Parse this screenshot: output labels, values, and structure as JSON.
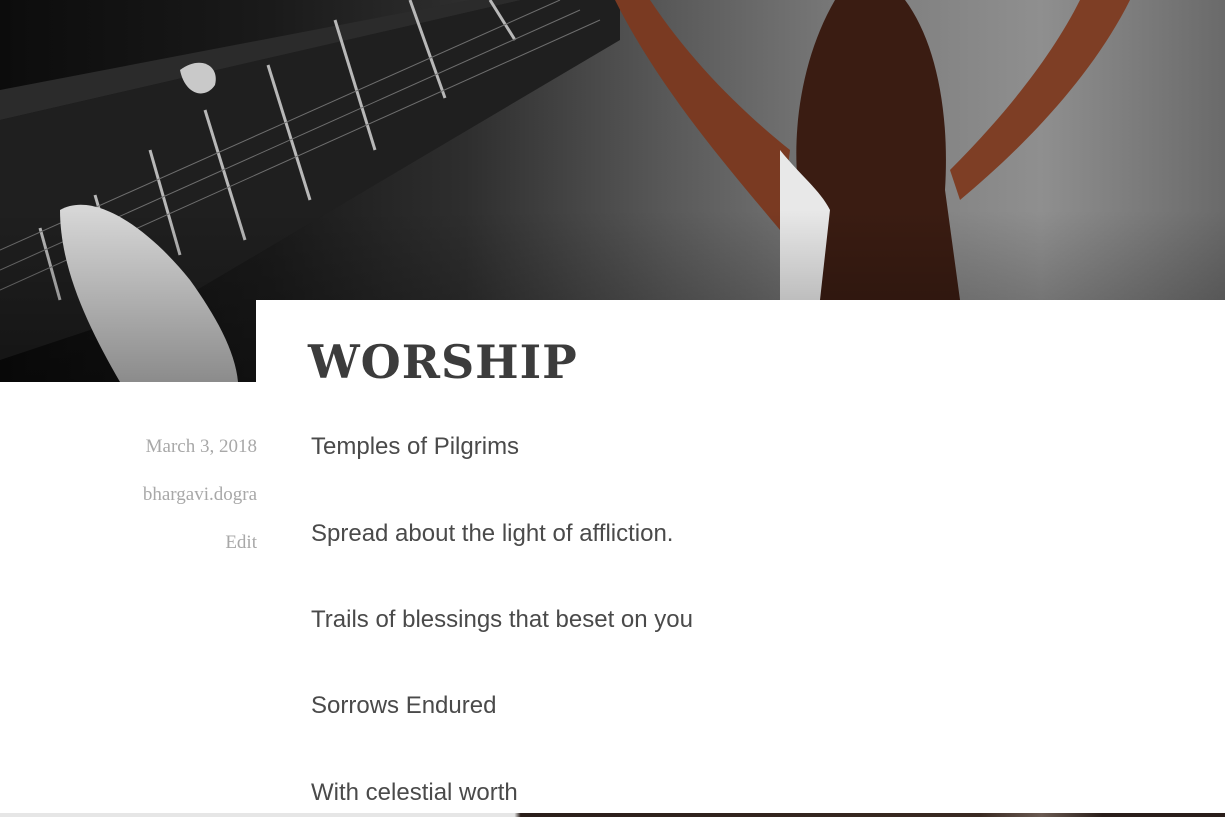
{
  "post": {
    "title": "WORSHIP",
    "date": "March 3, 2018",
    "author": "bhargavi.dogra",
    "edit_label": "Edit",
    "lines": [
      "Temples of Pilgrims",
      "Spread about the light of affliction.",
      "Trails of blessings that beset on you",
      "Sorrows Endured",
      "With celestial worth"
    ]
  },
  "colors": {
    "title": "#3c3c3c",
    "meta": "#a8a8a8",
    "body_text": "#4a4a4a",
    "background": "#ffffff"
  }
}
